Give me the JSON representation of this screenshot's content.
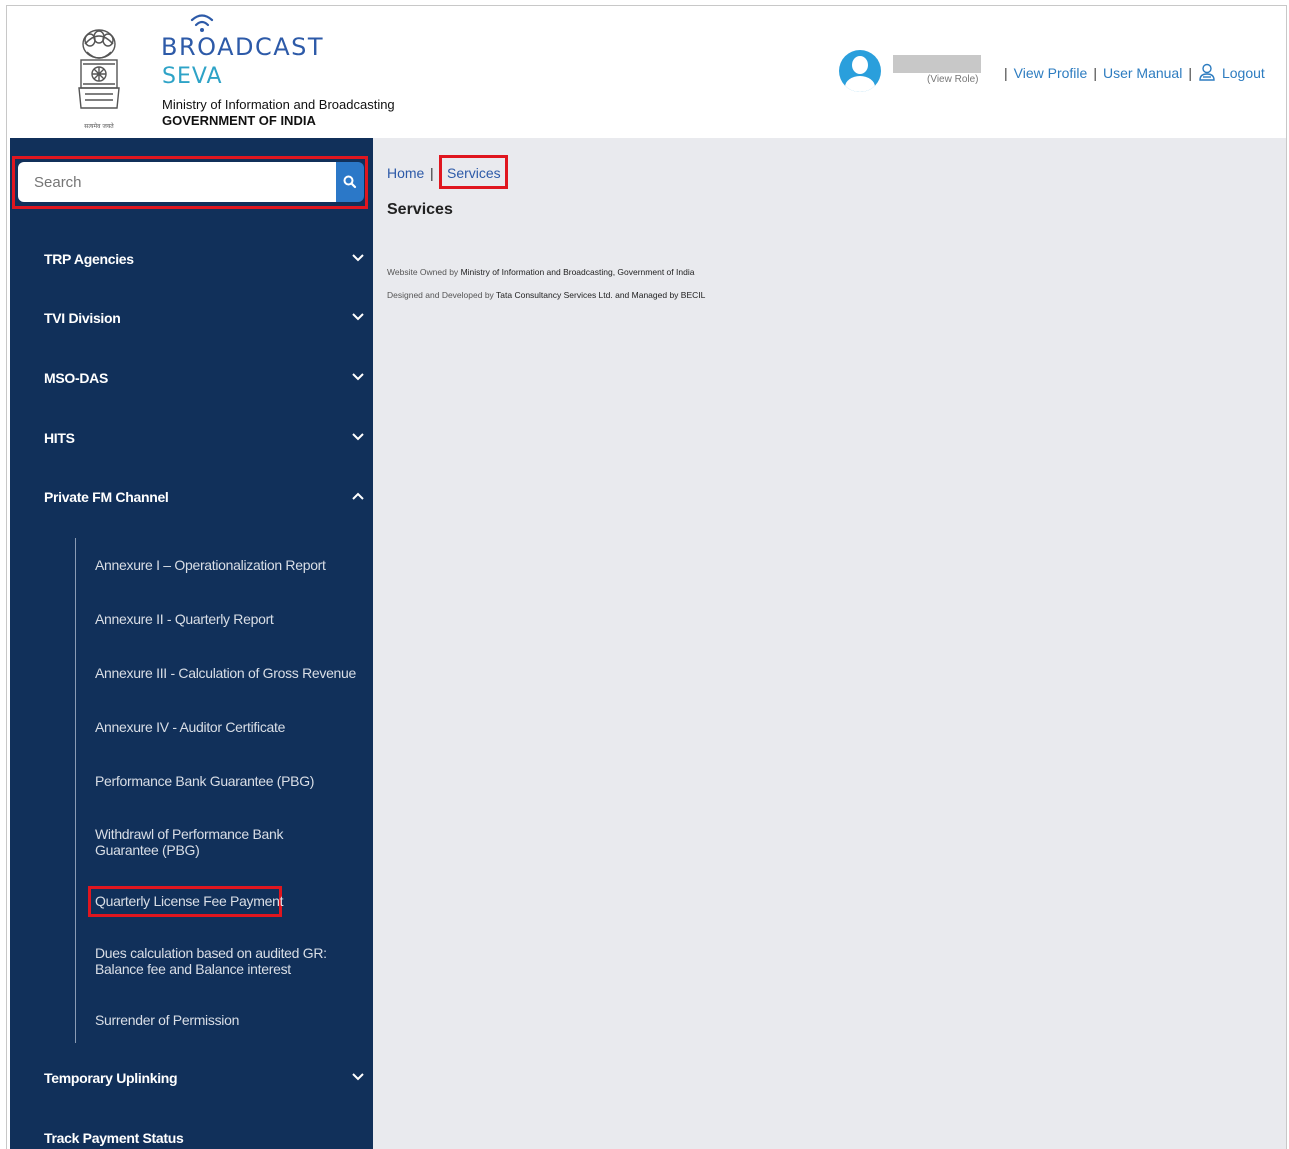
{
  "header": {
    "brand_line1": "BROADCAST",
    "brand_line2": "SEVA",
    "ministry": "Ministry of Information and Broadcasting",
    "government": "GOVERNMENT OF INDIA",
    "emblem_motto": "सत्यमेव जयते",
    "user": {
      "view_role": "(View Role)"
    },
    "links": {
      "view_profile": "View Profile",
      "user_manual": "User Manual",
      "logout": "Logout",
      "separator": "|"
    }
  },
  "sidebar": {
    "search": {
      "placeholder": "Search"
    },
    "items": [
      {
        "label": "TRP Agencies",
        "expanded": false
      },
      {
        "label": "TVI Division",
        "expanded": false
      },
      {
        "label": "MSO-DAS",
        "expanded": false
      },
      {
        "label": "HITS",
        "expanded": false
      },
      {
        "label": "Private FM Channel",
        "expanded": true
      },
      {
        "label": "Temporary Uplinking",
        "expanded": false
      },
      {
        "label": "Track Payment Status"
      }
    ],
    "private_fm_subitems": [
      "Annexure I – Operationalization Report",
      "Annexure II - Quarterly Report",
      "Annexure III - Calculation of Gross Revenue",
      "Annexure IV - Auditor Certificate",
      "Performance Bank Guarantee (PBG)",
      "Withdrawl of Performance Bank Guarantee (PBG)",
      "Quarterly License Fee Payment",
      "Dues calculation based on audited GR: Balance fee and Balance interest",
      "Surrender of Permission"
    ]
  },
  "breadcrumb": {
    "home": "Home",
    "separator": "|",
    "current": "Services"
  },
  "main": {
    "title": "Services",
    "footer": {
      "owned_prefix": "Website Owned by",
      "owned_by": "Ministry of Information and Broadcasting, Government of India",
      "dev_prefix": "Designed and Developed by",
      "dev_by": "Tata Consultancy Services Ltd. and Managed by BECIL"
    }
  },
  "colors": {
    "sidebar_bg": "#11305a",
    "highlight_box": "#e0161f",
    "link": "#2d7cc0",
    "main_bg": "#e9eaee"
  }
}
